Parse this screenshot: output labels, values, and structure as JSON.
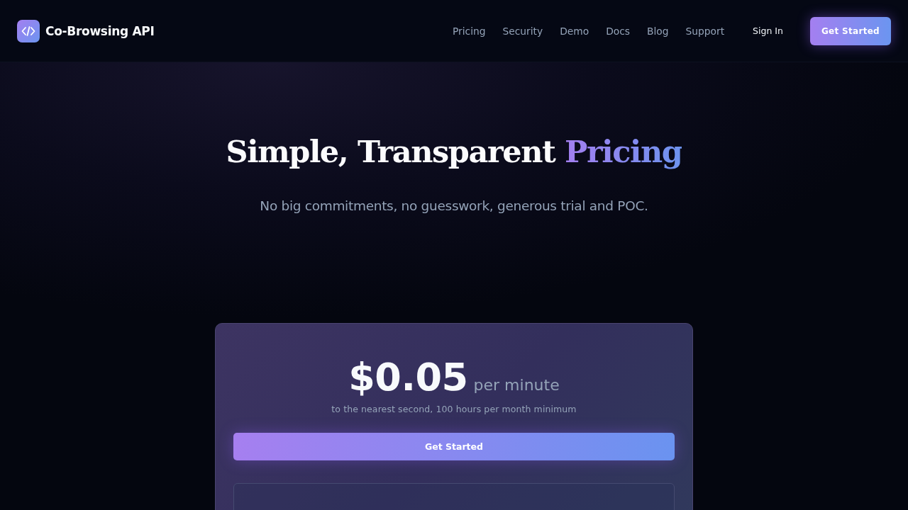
{
  "header": {
    "brand": "Co-Browsing API",
    "nav": [
      "Pricing",
      "Security",
      "Demo",
      "Docs",
      "Blog",
      "Support"
    ],
    "sign_in": "Sign In",
    "cta": "Get Started"
  },
  "hero": {
    "title": "Simple, Transparent",
    "title_highlight": "Pricing",
    "subtitle": "No big commitments, no guesswork, generous trial and POC."
  },
  "pricing_card": {
    "price": "$0.05",
    "unit": "per minute",
    "note": "to the nearest second, 100 hours per month minimum",
    "button": "Get Started"
  }
}
